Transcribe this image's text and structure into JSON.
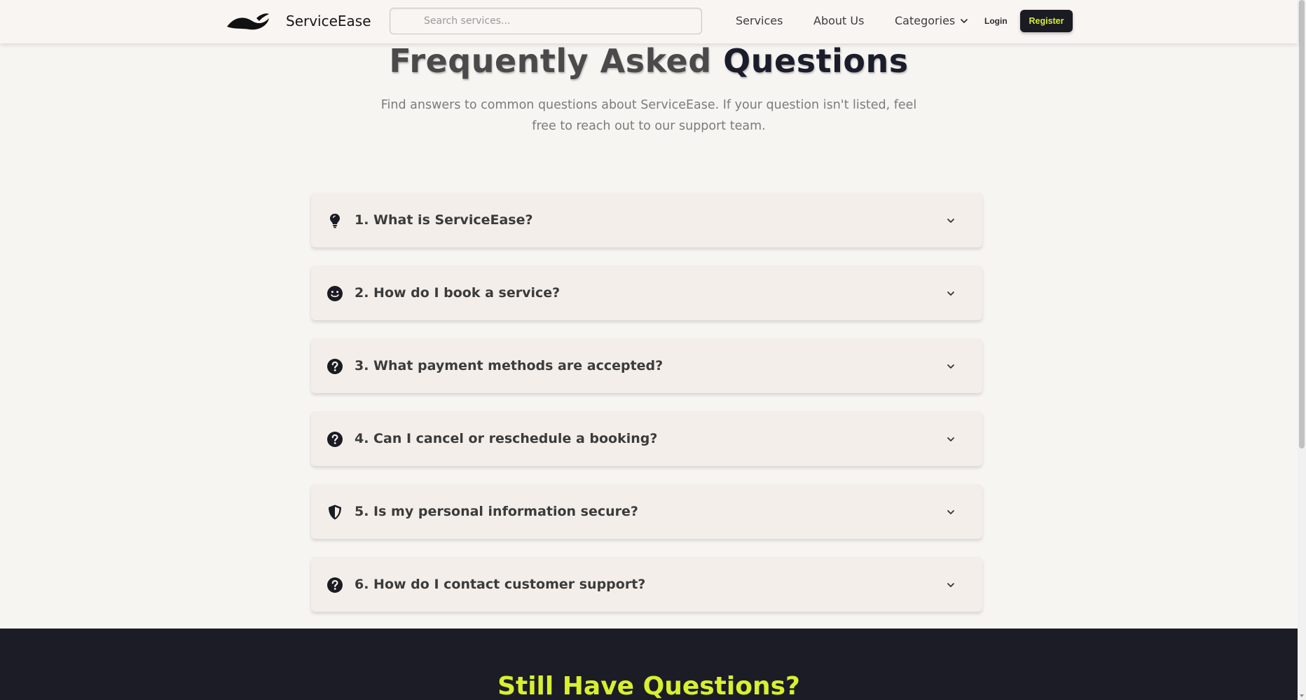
{
  "header": {
    "brand": "ServiceEase",
    "search_placeholder": "Search services...",
    "nav": {
      "services": "Services",
      "about": "About Us",
      "categories": "Categories"
    },
    "login": "Login",
    "register": "Register"
  },
  "hero": {
    "title_part1": "Frequently Asked ",
    "title_part2": "Questions",
    "subtitle": "Find answers to common questions about ServiceEase. If your question isn't listed, feel free to reach out to our support team."
  },
  "faq": [
    {
      "question": "1. What is ServiceEase?",
      "icon": "lightbulb-icon"
    },
    {
      "question": "2. How do I book a service?",
      "icon": "smile-icon"
    },
    {
      "question": "3. What payment methods are accepted?",
      "icon": "question-circle-icon"
    },
    {
      "question": "4. Can I cancel or reschedule a booking?",
      "icon": "question-circle-icon"
    },
    {
      "question": "5. Is my personal information secure?",
      "icon": "shield-icon"
    },
    {
      "question": "6. How do I contact customer support?",
      "icon": "question-circle-icon"
    }
  ],
  "cta": {
    "title": "Still Have Questions?"
  },
  "colors": {
    "accent": "#d8f02e",
    "dark": "#1c1c27",
    "background": "#f7f5f2",
    "card": "#f3eeea"
  }
}
